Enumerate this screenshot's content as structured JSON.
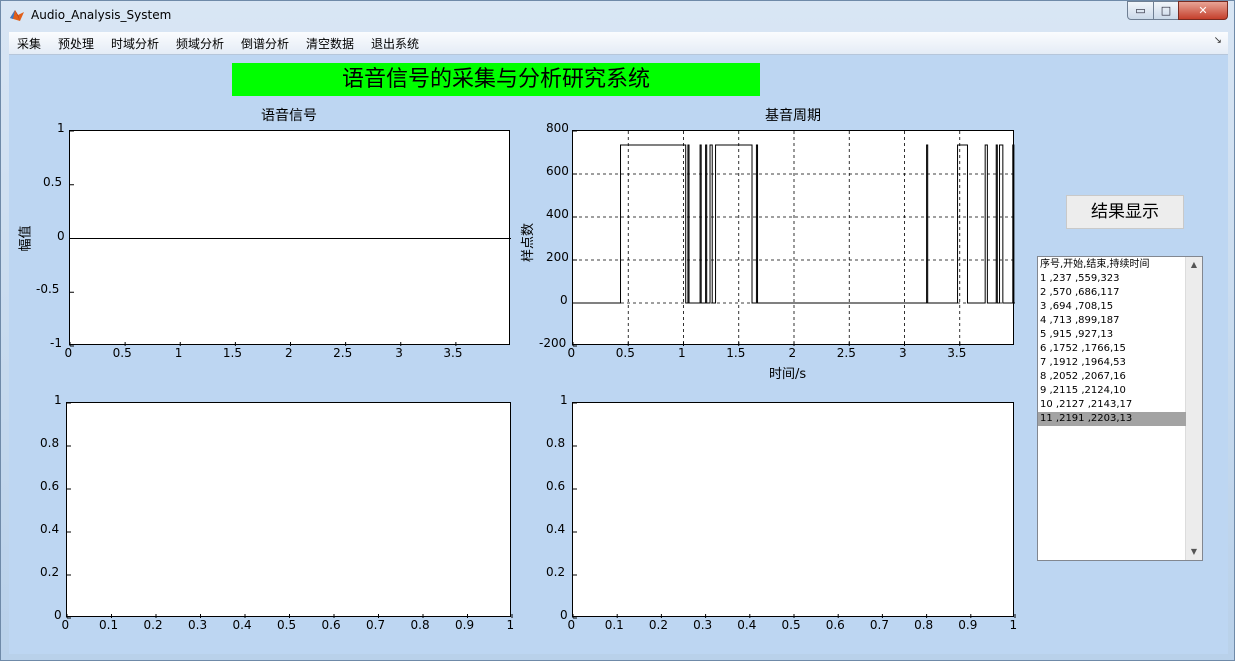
{
  "window": {
    "title": "Audio_Analysis_System",
    "controls": {
      "minimize": "▭",
      "maximize": "□",
      "close": "✕"
    }
  },
  "menu": [
    "采集",
    "预处理",
    "时域分析",
    "频域分析",
    "倒谱分析",
    "清空数据",
    "退出系统"
  ],
  "banner": "语音信号的采集与分析研究系统",
  "result_button": "结果显示",
  "results_list": {
    "items": [
      "序号,开始,结束,持续时间",
      "1 ,237 ,559,323",
      "2 ,570 ,686,117",
      "3 ,694 ,708,15",
      "4 ,713 ,899,187",
      "5 ,915 ,927,13",
      "6 ,1752 ,1766,15",
      "7 ,1912 ,1964,53",
      "8 ,2052 ,2067,16",
      "9 ,2115 ,2124,10",
      "10 ,2127 ,2143,17",
      "11 ,2191 ,2203,13"
    ],
    "selected_index": 11
  },
  "chart_data": [
    {
      "type": "line",
      "title": "语音信号",
      "xlabel": "",
      "ylabel": "幅值",
      "xlim": [
        0,
        4
      ],
      "ylim": [
        -1,
        1
      ],
      "xticks": [
        "0",
        "0.5",
        "1",
        "1.5",
        "2",
        "2.5",
        "3",
        "3.5"
      ],
      "yticks": [
        "1",
        "0.5",
        "0",
        "-0.5",
        "-1"
      ],
      "grid": false,
      "series": [
        {
          "x": [
            0,
            4
          ],
          "y": [
            0,
            0
          ]
        }
      ]
    },
    {
      "type": "line",
      "title": "基音周期",
      "xlabel": "时间/s",
      "ylabel": "样点数",
      "xlim": [
        0,
        4
      ],
      "ylim": [
        -200,
        800
      ],
      "xticks": [
        "0",
        "0.5",
        "1",
        "1.5",
        "2",
        "2.5",
        "3",
        "3.5"
      ],
      "yticks": [
        "800",
        "600",
        "400",
        "200",
        "0",
        "-200"
      ],
      "grid": true,
      "segments": [
        [
          0.43,
          1.02
        ],
        [
          1.04,
          1.05
        ],
        [
          1.15,
          1.16
        ],
        [
          1.2,
          1.21
        ],
        [
          1.24,
          1.26
        ],
        [
          1.29,
          1.62
        ],
        [
          1.66,
          1.67
        ],
        [
          3.2,
          3.21
        ],
        [
          3.48,
          3.57
        ],
        [
          3.73,
          3.75
        ],
        [
          3.83,
          3.84
        ],
        [
          3.86,
          3.89
        ],
        [
          3.98,
          3.99
        ]
      ],
      "segment_value": 735
    },
    {
      "type": "line",
      "title": "",
      "xlim": [
        0,
        1
      ],
      "ylim": [
        0,
        1
      ],
      "xticks": [
        "0",
        "0.1",
        "0.2",
        "0.3",
        "0.4",
        "0.5",
        "0.6",
        "0.7",
        "0.8",
        "0.9",
        "1"
      ],
      "yticks": [
        "1",
        "0.8",
        "0.6",
        "0.4",
        "0.2",
        "0"
      ],
      "grid": false,
      "series": []
    },
    {
      "type": "line",
      "title": "",
      "xlim": [
        0,
        1
      ],
      "ylim": [
        0,
        1
      ],
      "xticks": [
        "0",
        "0.1",
        "0.2",
        "0.3",
        "0.4",
        "0.5",
        "0.6",
        "0.7",
        "0.8",
        "0.9",
        "1"
      ],
      "yticks": [
        "1",
        "0.8",
        "0.6",
        "0.4",
        "0.2",
        "0"
      ],
      "grid": false,
      "series": []
    }
  ]
}
